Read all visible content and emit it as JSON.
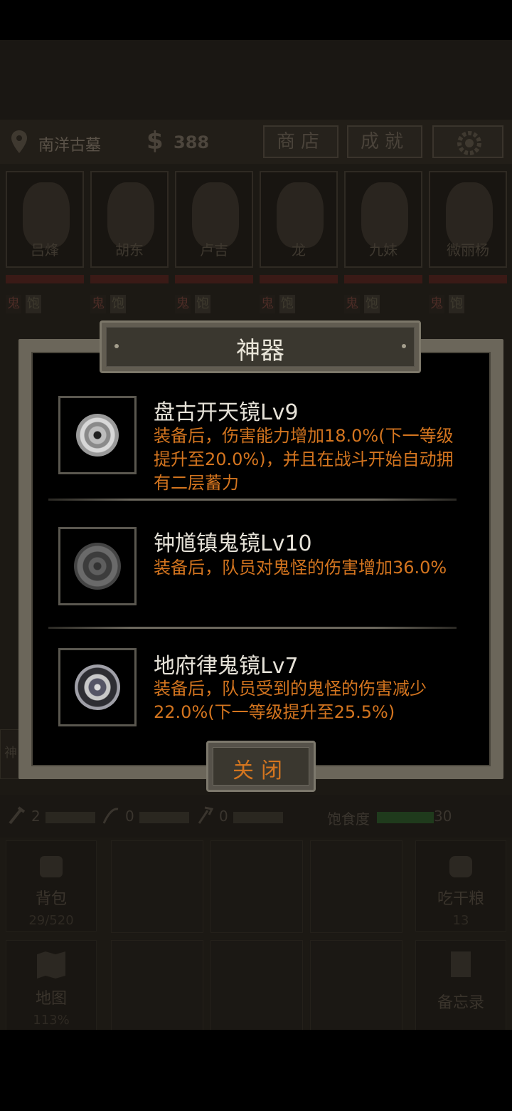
{
  "topbar": {
    "location": "南洋古墓",
    "currency_symbol": "$",
    "money": "388",
    "shop_label": "商店",
    "achievements_label": "成就"
  },
  "characters": [
    {
      "name": "吕烽",
      "tag_a": "鬼",
      "tag_b": "饱"
    },
    {
      "name": "胡东",
      "tag_a": "鬼",
      "tag_b": "饱"
    },
    {
      "name": "卢吉",
      "tag_a": "鬼",
      "tag_b": "饱"
    },
    {
      "name": "龙",
      "tag_a": "鬼",
      "tag_b": "饱"
    },
    {
      "name": "九妹",
      "tag_a": "鬼",
      "tag_b": "饱"
    },
    {
      "name": "微丽杨",
      "tag_a": "鬼",
      "tag_b": "饱"
    }
  ],
  "side_tab": "神",
  "tools": {
    "tool1_count": "2",
    "tool2_count": "0",
    "tool3_count": "0",
    "satiety_label": "饱食度",
    "satiety_value": "30"
  },
  "actions": {
    "backpack_label": "背包",
    "backpack_count": "29/520",
    "eat_label": "吃干粮",
    "eat_count": "13",
    "map_label": "地图",
    "map_percent": "113%",
    "memo_label": "备忘录"
  },
  "dialog": {
    "title": "神器",
    "items": [
      {
        "name": "盘古开天镜Lv9",
        "desc": "装备后，伤害能力增加18.0%(下一等级提升至20.0%)，并且在战斗开始自动拥有二层蓄力",
        "icon": "mirror-icon"
      },
      {
        "name": "钟馗镇鬼镜Lv10",
        "desc": "装备后，队员对鬼怪的伤害增加36.0%",
        "icon": "mirror-icon"
      },
      {
        "name": "地府律鬼镜Lv7",
        "desc": "装备后，队员受到的鬼怪的伤害减少22.0%(下一等级提升至25.5%)",
        "icon": "mirror-icon"
      }
    ],
    "close_label": "关闭"
  },
  "colors": {
    "desc_orange": "#d4751f",
    "frame": "#6b665a",
    "hp_red": "#3a1a16"
  }
}
